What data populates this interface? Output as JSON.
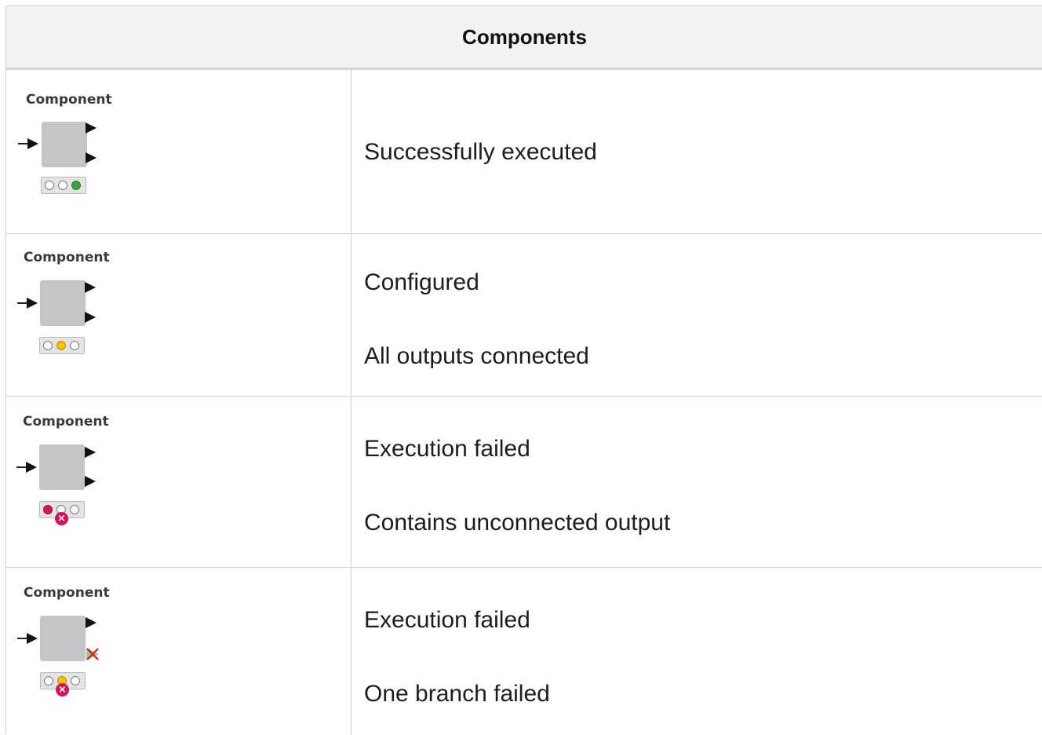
{
  "header": {
    "title": "Components"
  },
  "colors": {
    "executed": "#3aa63a",
    "configured": "#f2c100",
    "failed": "#d4145a",
    "node_gray": "#c4c5c7"
  },
  "rows": [
    {
      "node_label": "Component",
      "status": "executed",
      "lines": [
        "Successfully executed"
      ]
    },
    {
      "node_label": "Component",
      "status": "configured",
      "lines": [
        "Configured",
        "All outputs connected"
      ]
    },
    {
      "node_label": "Component",
      "status": "failed",
      "lines": [
        "Execution failed",
        "Contains unconnected output"
      ]
    },
    {
      "node_label": "Component",
      "status": "branch-failed",
      "lines": [
        "Execution failed",
        "One branch failed"
      ]
    }
  ]
}
